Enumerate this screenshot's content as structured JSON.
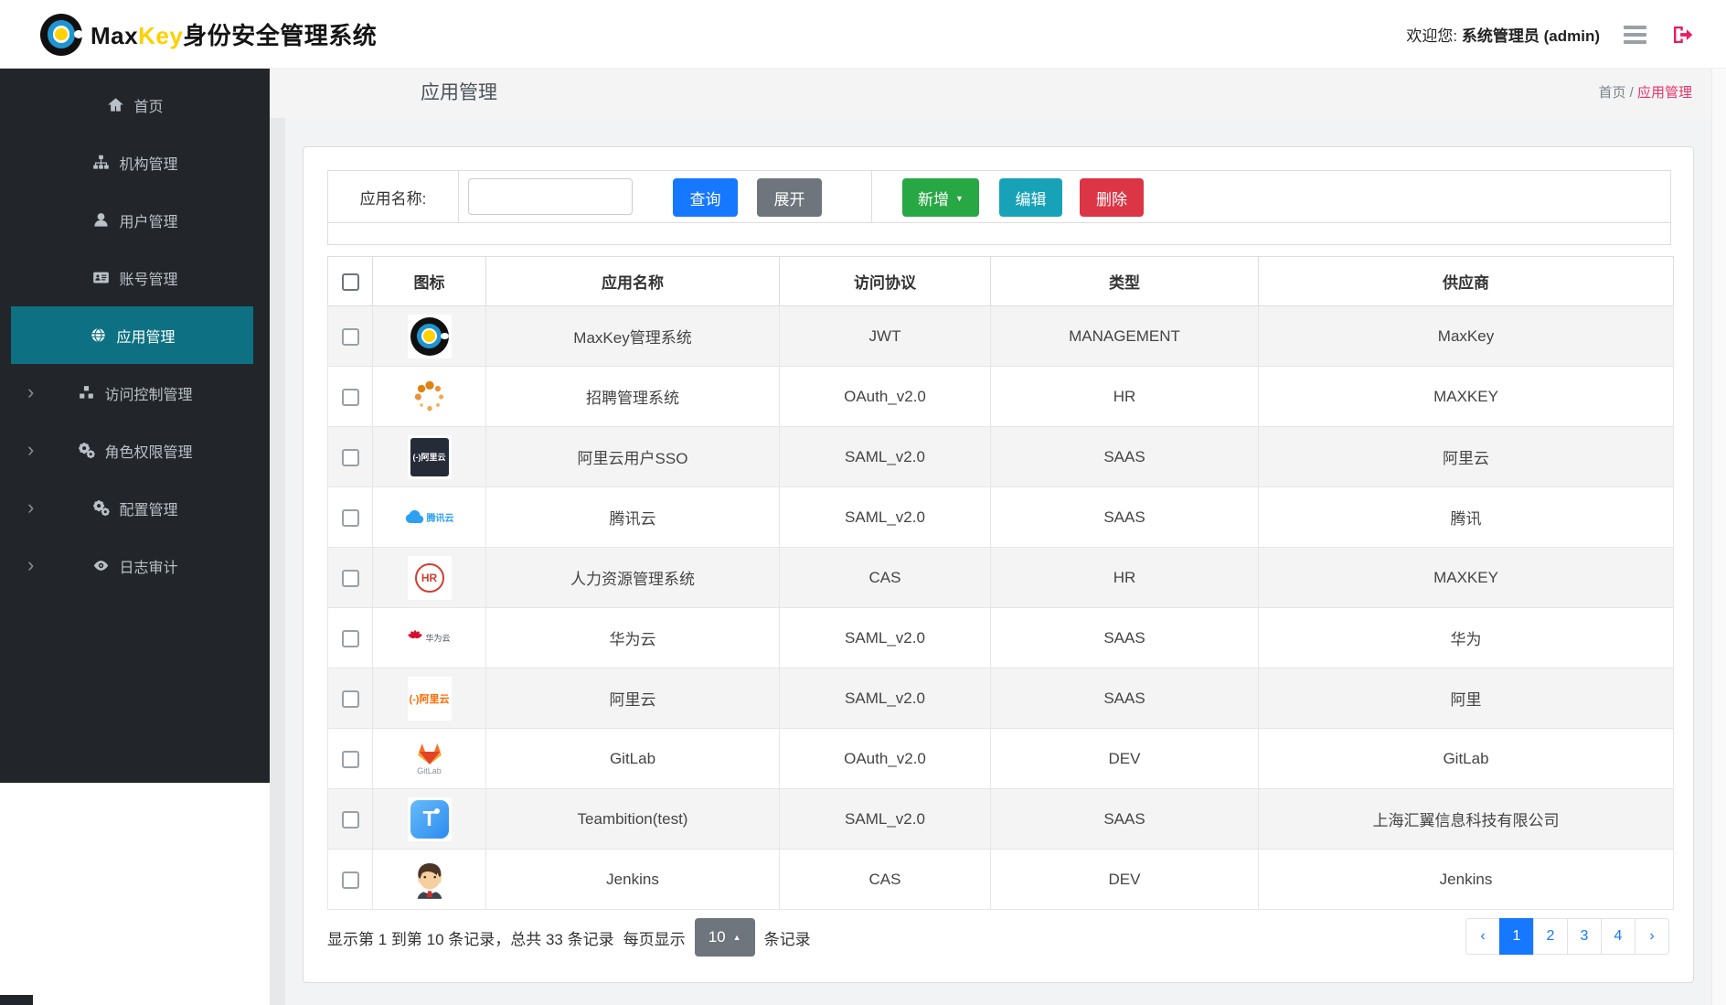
{
  "header": {
    "brand_max": "Max",
    "brand_key": "Key",
    "brand_suffix": "身份安全管理系统",
    "welcome_prefix": "欢迎您:",
    "welcome_user": "系统管理员 (admin)"
  },
  "sidebar": {
    "items": [
      {
        "label": "首页",
        "icon": "home-icon",
        "active": false,
        "expandable": false
      },
      {
        "label": "机构管理",
        "icon": "sitemap-icon",
        "active": false,
        "expandable": false
      },
      {
        "label": "用户管理",
        "icon": "user-icon",
        "active": false,
        "expandable": false
      },
      {
        "label": "账号管理",
        "icon": "id-card-icon",
        "active": false,
        "expandable": false
      },
      {
        "label": "应用管理",
        "icon": "globe-icon",
        "active": true,
        "expandable": false
      },
      {
        "label": "访问控制管理",
        "icon": "cubes-icon",
        "active": false,
        "expandable": true
      },
      {
        "label": "角色权限管理",
        "icon": "gears-icon",
        "active": false,
        "expandable": true
      },
      {
        "label": "配置管理",
        "icon": "gears-icon",
        "active": false,
        "expandable": true
      },
      {
        "label": "日志审计",
        "icon": "eye-icon",
        "active": false,
        "expandable": true
      }
    ]
  },
  "page": {
    "title": "应用管理",
    "breadcrumb_home": "首页",
    "breadcrumb_sep": " / ",
    "breadcrumb_current": "应用管理"
  },
  "toolbar": {
    "search_label": "应用名称:",
    "search_value": "",
    "query_label": "查询",
    "expand_label": "展开",
    "add_label": "新增",
    "edit_label": "编辑",
    "delete_label": "删除"
  },
  "table": {
    "headers": [
      "图标",
      "应用名称",
      "访问协议",
      "类型",
      "供应商"
    ],
    "rows": [
      {
        "icon": "maxkey",
        "name": "MaxKey管理系统",
        "protocol": "JWT",
        "type": "MANAGEMENT",
        "vendor": "MaxKey"
      },
      {
        "icon": "spinner",
        "name": "招聘管理系统",
        "protocol": "OAuth_v2.0",
        "type": "HR",
        "vendor": "MAXKEY"
      },
      {
        "icon": "aliyun-dark",
        "name": "阿里云用户SSO",
        "protocol": "SAML_v2.0",
        "type": "SAAS",
        "vendor": "阿里云"
      },
      {
        "icon": "tencent",
        "name": "腾讯云",
        "protocol": "SAML_v2.0",
        "type": "SAAS",
        "vendor": "腾讯"
      },
      {
        "icon": "hr",
        "name": "人力资源管理系统",
        "protocol": "CAS",
        "type": "HR",
        "vendor": "MAXKEY"
      },
      {
        "icon": "huawei",
        "name": "华为云",
        "protocol": "SAML_v2.0",
        "type": "SAAS",
        "vendor": "华为"
      },
      {
        "icon": "aliyun-orange",
        "name": "阿里云",
        "protocol": "SAML_v2.0",
        "type": "SAAS",
        "vendor": "阿里"
      },
      {
        "icon": "gitlab",
        "name": "GitLab",
        "protocol": "OAuth_v2.0",
        "type": "DEV",
        "vendor": "GitLab"
      },
      {
        "icon": "teambition",
        "name": "Teambition(test)",
        "protocol": "SAML_v2.0",
        "type": "SAAS",
        "vendor": "上海汇翼信息科技有限公司"
      },
      {
        "icon": "jenkins",
        "name": "Jenkins",
        "protocol": "CAS",
        "type": "DEV",
        "vendor": "Jenkins"
      }
    ]
  },
  "pagination": {
    "summary": "显示第 1 到第 10 条记录，总共 33 条记录",
    "per_page_prefix": "每页显示",
    "page_size": "10",
    "per_page_suffix": "条记录",
    "prev": "‹",
    "next": "›",
    "pages": [
      "1",
      "2",
      "3",
      "4"
    ],
    "active_page": "1"
  },
  "colors": {
    "sidebar_bg": "#22262a",
    "sidebar_active": "#0d7183",
    "primary_blue": "#1677ff",
    "success_green": "#28a745",
    "info_teal": "#17a2b8",
    "danger_red": "#dc3545",
    "secondary_gray": "#6e757c",
    "breadcrumb_pink": "#e8336b",
    "brand_yellow": "#fdd000"
  }
}
